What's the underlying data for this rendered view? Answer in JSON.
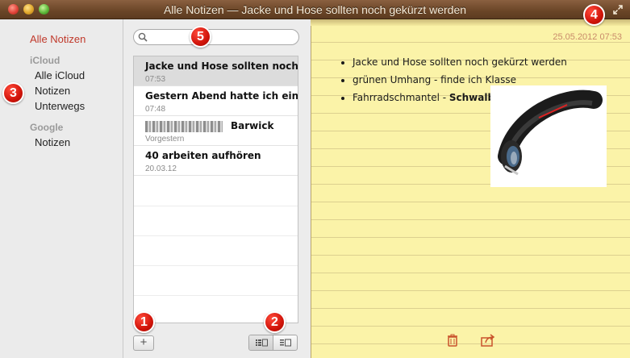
{
  "window": {
    "title": "Alle Notizen — Jacke und Hose sollten noch gekürzt werden"
  },
  "sidebar": {
    "all_notes": "Alle Notizen",
    "groups": [
      {
        "label": "iCloud",
        "items": [
          "Alle iCloud",
          "Notizen",
          "Unterwegs"
        ]
      },
      {
        "label": "Google",
        "items": [
          "Notizen"
        ]
      }
    ]
  },
  "search": {
    "placeholder": ""
  },
  "notes": [
    {
      "title": "Jacke und Hose sollten noch...",
      "date": "07:53",
      "selected": true
    },
    {
      "title": "Gestern Abend hatte ich eine l...",
      "date": "07:48"
    },
    {
      "title": "Barwick",
      "date": "Vorgestern",
      "title_prefix_blurred": true
    },
    {
      "title": "40 arbeiten aufhören",
      "date": "20.03.12"
    }
  ],
  "toolbar": {
    "add_label": "+"
  },
  "note": {
    "date": "25.05.2012 07:53",
    "lines": [
      {
        "text": "Jacke und Hose sollten noch gekürzt werden"
      },
      {
        "text": "grünen Umhang - finde ich Klasse"
      },
      {
        "text": "Fahrradschmantel - ",
        "bold_suffix": "Schwalbe"
      }
    ]
  },
  "callouts": [
    "1",
    "2",
    "3",
    "4",
    "5"
  ],
  "colors": {
    "accent_red": "#c0392b",
    "paper": "#fbf3a8",
    "leather": "#6a4527",
    "callout_red": "#d1140a"
  }
}
